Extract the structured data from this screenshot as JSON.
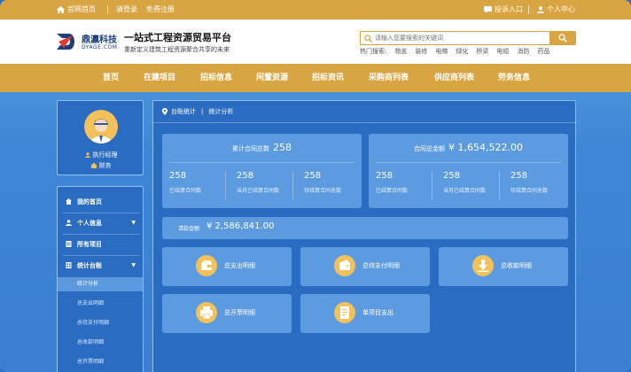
{
  "topbar": {
    "home": "官网首页",
    "login": "请登录",
    "register": "免费注册",
    "complaint": "投诉入口",
    "personal_center": "个人中心"
  },
  "header": {
    "logo_cn": "鼎瀛科技",
    "logo_en": "DYAGE.COM",
    "slogan_title": "一站式工程资源贸易平台",
    "slogan_sub": "重新定义建筑工程资源聚合共享的未来",
    "search_placeholder": "请输入您要搜索的关键词",
    "hot_label": "热门搜索:",
    "hot_keywords": [
      "物盖",
      "装修",
      "电梯",
      "绿化",
      "桥梁",
      "电缆",
      "消防",
      "药品"
    ]
  },
  "nav": {
    "items": [
      "首页",
      "在建项目",
      "招标信息",
      "闲置资源",
      "招标资讯",
      "采购商列表",
      "供应商列表",
      "劳务信息"
    ]
  },
  "profile": {
    "role": "执行经理",
    "dept": "财务"
  },
  "menu": {
    "home": "我的首页",
    "personal": "个人信息",
    "projects": "所有项目",
    "ledger": "统计台账",
    "sub": [
      "统计分析",
      "总支出明细",
      "总待支付明细",
      "总收款明细",
      "总开票明细"
    ]
  },
  "breadcrumb": {
    "root": "台账统计",
    "sep": "|",
    "current": "统计分析"
  },
  "stats": {
    "contracts": {
      "label": "累计合同总数",
      "value": "258",
      "cells": [
        {
          "value": "258",
          "label": "已结算合同数"
        },
        {
          "value": "258",
          "label": "当月已结算合同数"
        },
        {
          "value": "258",
          "label": "待结算合同总数"
        }
      ]
    },
    "amount": {
      "label": "合同总金额",
      "value": "¥ 1,654,522.00",
      "cells": [
        {
          "value": "258",
          "label": "已结算合同数"
        },
        {
          "value": "258",
          "label": "当月已结算合同数"
        },
        {
          "value": "258",
          "label": "待结算合同总数"
        }
      ]
    },
    "payment": {
      "label": "请款金额",
      "value": "¥ 2,586,841.00"
    }
  },
  "actions": [
    "总支出明细",
    "总待支付明细",
    "总收款明细",
    "总开票明细",
    "单项目支出"
  ],
  "colors": {
    "gold": "#d9a442",
    "panel": "#2a6cc2",
    "card": "#5d9be0",
    "icon": "#f2c15a"
  }
}
